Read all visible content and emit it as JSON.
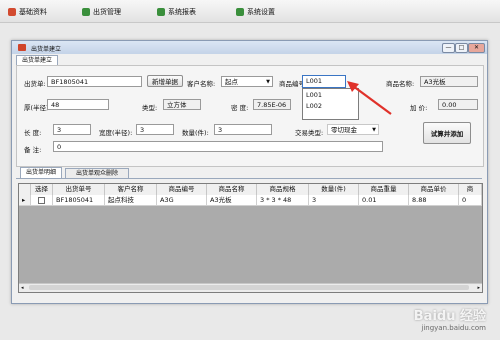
{
  "menu": {
    "items": [
      {
        "label": "基础资料",
        "color": "#d24a2f"
      },
      {
        "label": "出货管理",
        "color": "#3a8f3c"
      },
      {
        "label": "系统报表",
        "color": "#3a8f3c"
      },
      {
        "label": "系统设置",
        "color": "#3a8f3c"
      }
    ]
  },
  "window": {
    "title": "出货单建立",
    "tab_main": "出货单建立",
    "min_label": "—",
    "max_label": "□",
    "close_label": "✕"
  },
  "form": {
    "order_no_label": "出货单:",
    "order_no_value": "BF1805041",
    "new_order_button": "新增单据",
    "customer_label": "客户名称:",
    "customer_value": "起点",
    "product_code_label": "商品编号:",
    "product_code_value": "L001",
    "product_name_label": "商品名称:",
    "product_name_value": "A3光板",
    "thickness_label": "厚(半径):",
    "thickness_value": "48",
    "type_label": "类型:",
    "type_value": "立方体",
    "density_label": "密 度:",
    "density_value": "7.85E-06",
    "addprice_label": "加 价:",
    "addprice_value": "0.00",
    "length_label": "长 度:",
    "length_value": "3",
    "width_label": "宽度(半径):",
    "width_value": "3",
    "qty_label": "数量(件):",
    "qty_value": "3",
    "trade_label": "交易类型:",
    "trade_value": "零切现金",
    "remark_label": "备 注:",
    "remark_value": "0",
    "calc_button": "试算并添加",
    "dropdown_options": [
      "L001",
      "L002"
    ]
  },
  "grid": {
    "tabs": [
      "出货单明细",
      "出货单观众删除"
    ],
    "columns": [
      "选择",
      "出货单号",
      "客户名称",
      "商品编号",
      "商品名称",
      "商品规格",
      "数量(件)",
      "商品重量",
      "商品单价",
      "商"
    ],
    "rows": [
      {
        "selected": "",
        "order_no": "BF1805041",
        "customer": "起点科技",
        "code": "A3G",
        "name": "A3光板",
        "spec": "3 * 3 * 48",
        "qty": "3",
        "weight": "0.01",
        "price": "8.88",
        "extra": "0"
      }
    ],
    "row_marker": "▸"
  },
  "watermark": {
    "brand": "Baidu 经验",
    "url": "jingyan.baidu.com"
  },
  "colors": {
    "arrow": "#e0312a",
    "selection_border": "#3a75c4"
  }
}
